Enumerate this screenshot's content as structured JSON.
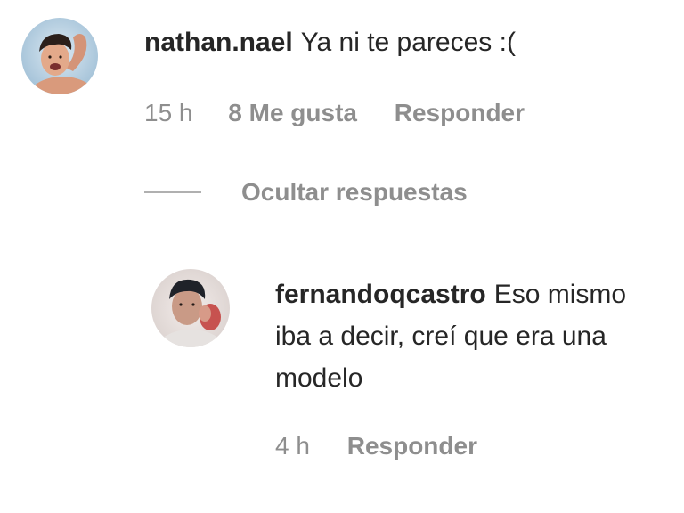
{
  "comments": [
    {
      "username": "nathan.nael",
      "text": "Ya ni te pareces :(",
      "time": "15 h",
      "likes": "8 Me gusta",
      "reply": "Responder",
      "avatar_icon": "user-avatar-icon"
    }
  ],
  "toggle_replies": "Ocultar respuestas",
  "replies": [
    {
      "username": "fernandoqcastro",
      "text": "Eso mismo iba a decir, creí que era una modelo",
      "time": "4 h",
      "reply": "Responder",
      "avatar_icon": "user-avatar-icon"
    }
  ],
  "colors": {
    "text": "#262626",
    "muted": "#8e8e8e",
    "divider": "#b0b0b0"
  }
}
